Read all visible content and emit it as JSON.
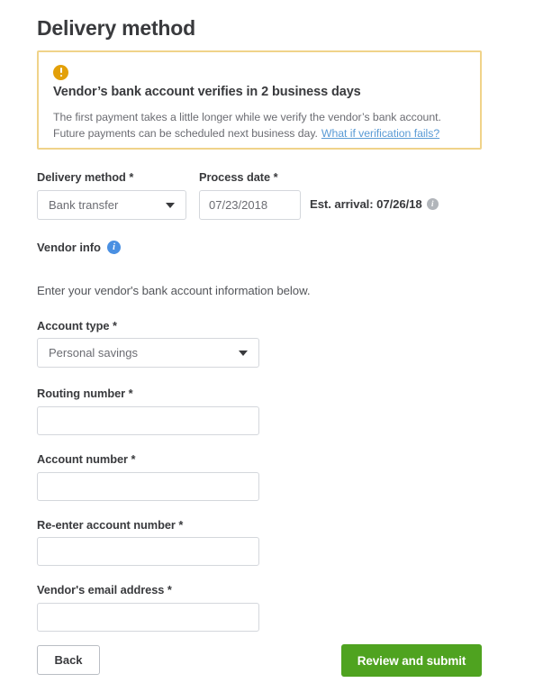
{
  "page": {
    "title": "Delivery method"
  },
  "alert": {
    "icon": "warning-exclamation-icon",
    "title": "Vendor’s bank account verifies in 2 business days",
    "body": "The first payment takes a little longer while we verify the vendor’s bank account. Future payments can be scheduled next business day.",
    "link_text": "What if verification fails?",
    "border_color": "#f0d38a",
    "icon_color": "#e3a008",
    "link_color": "#5a9bd5"
  },
  "form": {
    "delivery_method": {
      "label": "Delivery method *",
      "value": "Bank transfer",
      "options": [
        "Bank transfer"
      ]
    },
    "process_date": {
      "label": "Process date *",
      "value": "07/23/2018",
      "placeholder": "mm/dd/yyyy"
    },
    "est_arrival": {
      "text": "Est. arrival: 07/26/18",
      "icon": "info-icon"
    },
    "vendor_info": {
      "heading": "Vendor info",
      "icon": "info-icon",
      "helper_text": "Enter your vendor's bank account information below."
    },
    "account_type": {
      "label": "Account type *",
      "value": "Personal savings",
      "options": [
        "Personal savings"
      ]
    },
    "routing_number": {
      "label": "Routing number *",
      "value": "",
      "placeholder": ""
    },
    "account_number": {
      "label": "Account number *",
      "value": "",
      "placeholder": ""
    },
    "reenter_account_number": {
      "label": "Re-enter account number *",
      "value": "",
      "placeholder": ""
    },
    "vendor_email": {
      "label": "Vendor's email address *",
      "value": "",
      "placeholder": ""
    }
  },
  "actions": {
    "back_label": "Back",
    "submit_label": "Review and submit",
    "submit_color": "#4fa320"
  }
}
